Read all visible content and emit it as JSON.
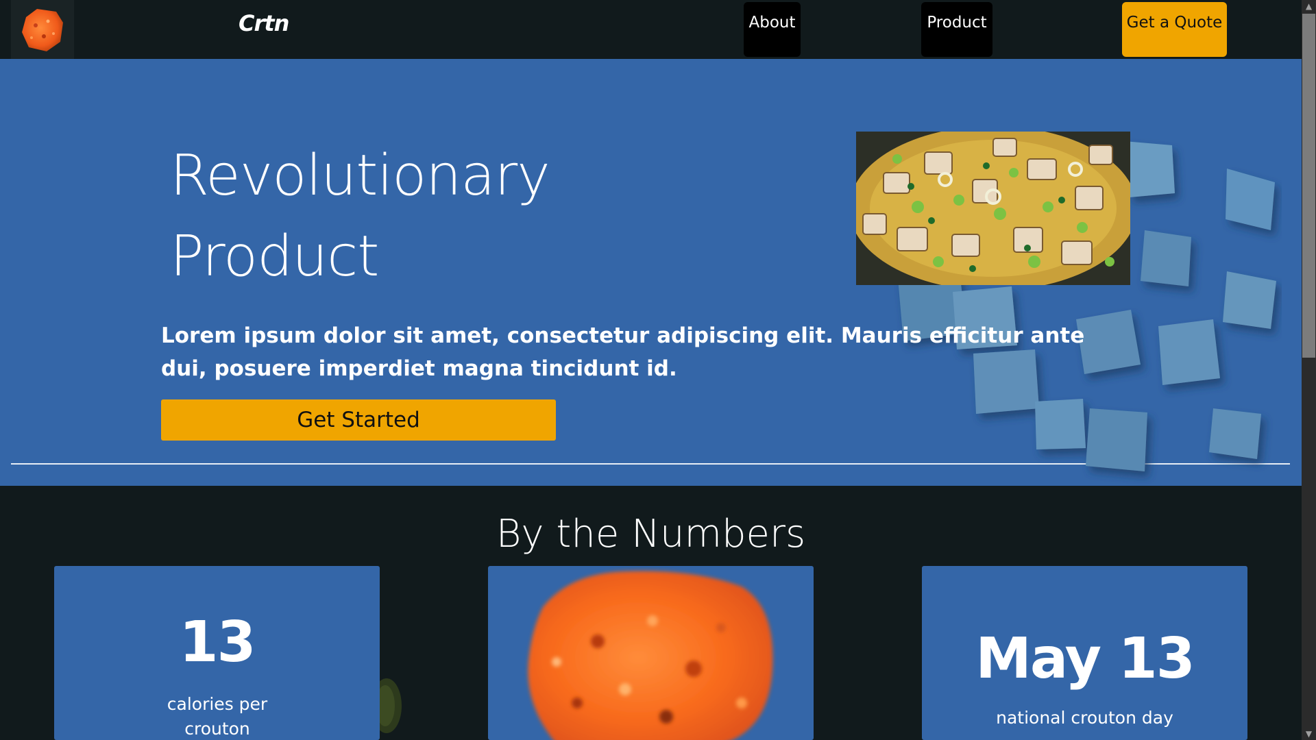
{
  "nav": {
    "brand": "Crtn",
    "links": [
      {
        "label": "About"
      },
      {
        "label": "Product"
      }
    ],
    "quote_label": "Get a Quote",
    "logo_icon": "crouton-logo-icon"
  },
  "hero": {
    "title_line1": "Revolutionary",
    "title_line2": "Product",
    "text": "Lorem ipsum dolor sit amet, consectetur adipiscing elit. Mauris efficitur ante dui, posuere imperdiet magna tincidunt id.",
    "cta_label": "Get Started"
  },
  "numbers": {
    "title": "By the Numbers",
    "cards": [
      {
        "value": "13",
        "label": "calories per crouton"
      },
      {
        "image": "crouton-closeup-image"
      },
      {
        "value": "May 13",
        "label": "national crouton day"
      }
    ]
  },
  "colors": {
    "background": "#111a1c",
    "hero": "#3466a8",
    "accent": "#f0a500",
    "nav_button": "#000000"
  }
}
